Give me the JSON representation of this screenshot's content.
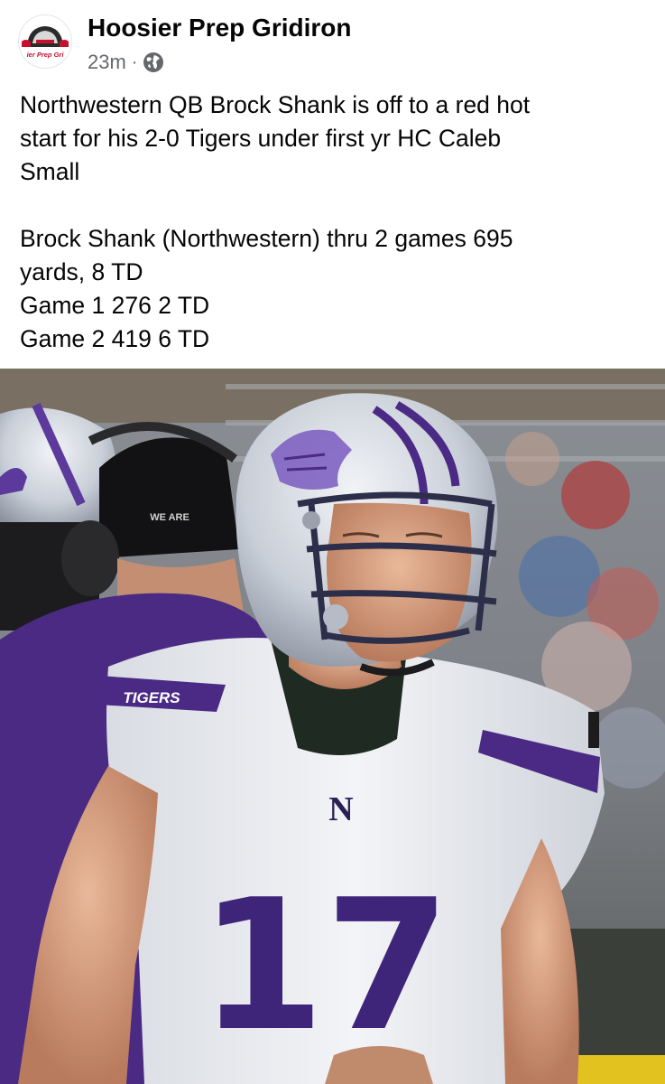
{
  "post": {
    "page_name": "Hoosier Prep Gridiron",
    "avatar_text": "ier Prep Gri",
    "timestamp": "23m",
    "separator": "·",
    "audience_icon": "globe-icon",
    "caption_lines": [
      "Northwestern QB Brock Shank is off to a red hot",
      "start for his 2-0 Tigers under first yr HC Caleb",
      "Small",
      "",
      "Brock Shank (Northwestern) thru 2 games 695",
      "yards,  8 TD",
      "Game 1 276 2 TD",
      "Game 2 419 6 TD"
    ]
  },
  "photo": {
    "sleeve_text": "TIGERS",
    "jersey_letter": "N",
    "jersey_number": "17",
    "headset_text": "WE ARE",
    "colors": {
      "purple": "#4b2a86",
      "jersey_white": "#eceef2",
      "helmet_silver": "#c9cfd8"
    }
  }
}
